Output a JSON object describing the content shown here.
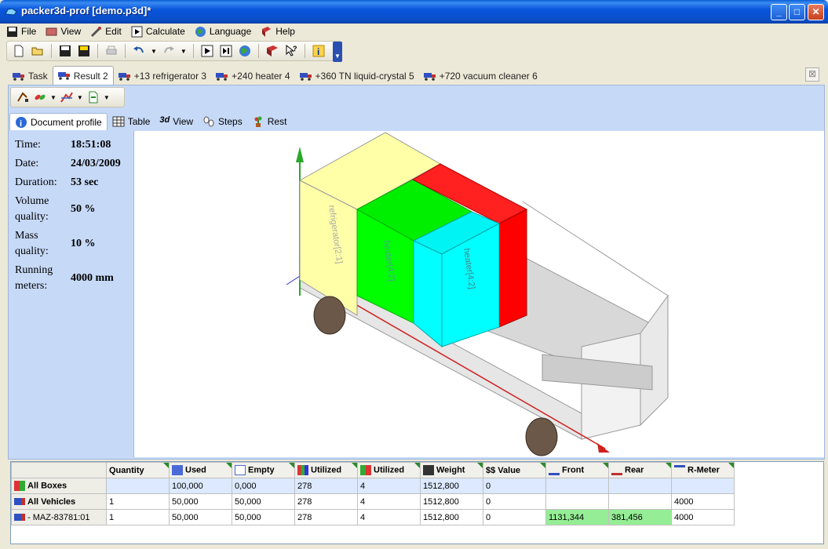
{
  "window": {
    "title": "packer3d-prof [demo.p3d]*"
  },
  "menu": [
    {
      "label": "File",
      "icon": "floppy-icon"
    },
    {
      "label": "View",
      "icon": "eye-icon"
    },
    {
      "label": "Edit",
      "icon": "tools-icon"
    },
    {
      "label": "Calculate",
      "icon": "play-icon"
    },
    {
      "label": "Language",
      "icon": "globe-icon"
    },
    {
      "label": "Help",
      "icon": "book-icon"
    }
  ],
  "tabs": [
    {
      "label": "Task",
      "icon": "truck-icon"
    },
    {
      "label": "Result 2",
      "icon": "truck-icon",
      "active": true
    },
    {
      "label": "+13 refrigerator 3",
      "icon": "truck-icon"
    },
    {
      "label": "+240 heater 4",
      "icon": "truck-icon"
    },
    {
      "label": "+360 TN liquid-crystal 5",
      "icon": "truck-icon"
    },
    {
      "label": "+720 vacuum cleaner 6",
      "icon": "truck-icon"
    }
  ],
  "subtabs": [
    {
      "label": "Document profile",
      "icon": "info-icon",
      "active": true
    },
    {
      "label": "Table",
      "icon": "table-icon"
    },
    {
      "label": "View",
      "icon": "3d-icon"
    },
    {
      "label": "Steps",
      "icon": "steps-icon"
    },
    {
      "label": "Rest",
      "icon": "plant-icon"
    }
  ],
  "profile": {
    "time_label": "Time:",
    "time": "18:51:08",
    "date_label": "Date:",
    "date": "24/03/2009",
    "duration_label": "Duration:",
    "duration": "53 sec",
    "volume_label_1": "Volume",
    "volume_label_2": "quality:",
    "volume": "50 %",
    "mass_label_1": "Mass",
    "mass_label_2": "quality:",
    "mass": "10 %",
    "running_label_1": "Running",
    "running_label_2": "meters:",
    "running": "4000 mm"
  },
  "view3d": {
    "box_labels": [
      "refrigerator[2:1]",
      "heater[4:2]",
      "heater[4:2]"
    ],
    "colors": {
      "yellow": "#ffffa8",
      "green": "#00ff00",
      "cyan": "#00ffff",
      "red": "#ff0000"
    }
  },
  "grid": {
    "headers": [
      "Quantity",
      "Used",
      "Empty",
      "Utilized",
      "Utilized",
      "Weight",
      "$$ Value",
      "Front",
      "Rear",
      "R-Meter"
    ],
    "rows": [
      {
        "name": "All Boxes",
        "cells": [
          "",
          "100,000",
          "0,000",
          "278",
          "4",
          "1512,800",
          "0",
          "",
          "",
          ""
        ]
      },
      {
        "name": "All Vehicles",
        "cells": [
          "1",
          "50,000",
          "50,000",
          "278",
          "4",
          "1512,800",
          "0",
          "",
          "",
          "4000"
        ]
      },
      {
        "name": "- MAZ-83781:01",
        "cells": [
          "1",
          "50,000",
          "50,000",
          "278",
          "4",
          "1512,800",
          "0",
          "1131,344",
          "381,456",
          "4000"
        ]
      }
    ]
  }
}
